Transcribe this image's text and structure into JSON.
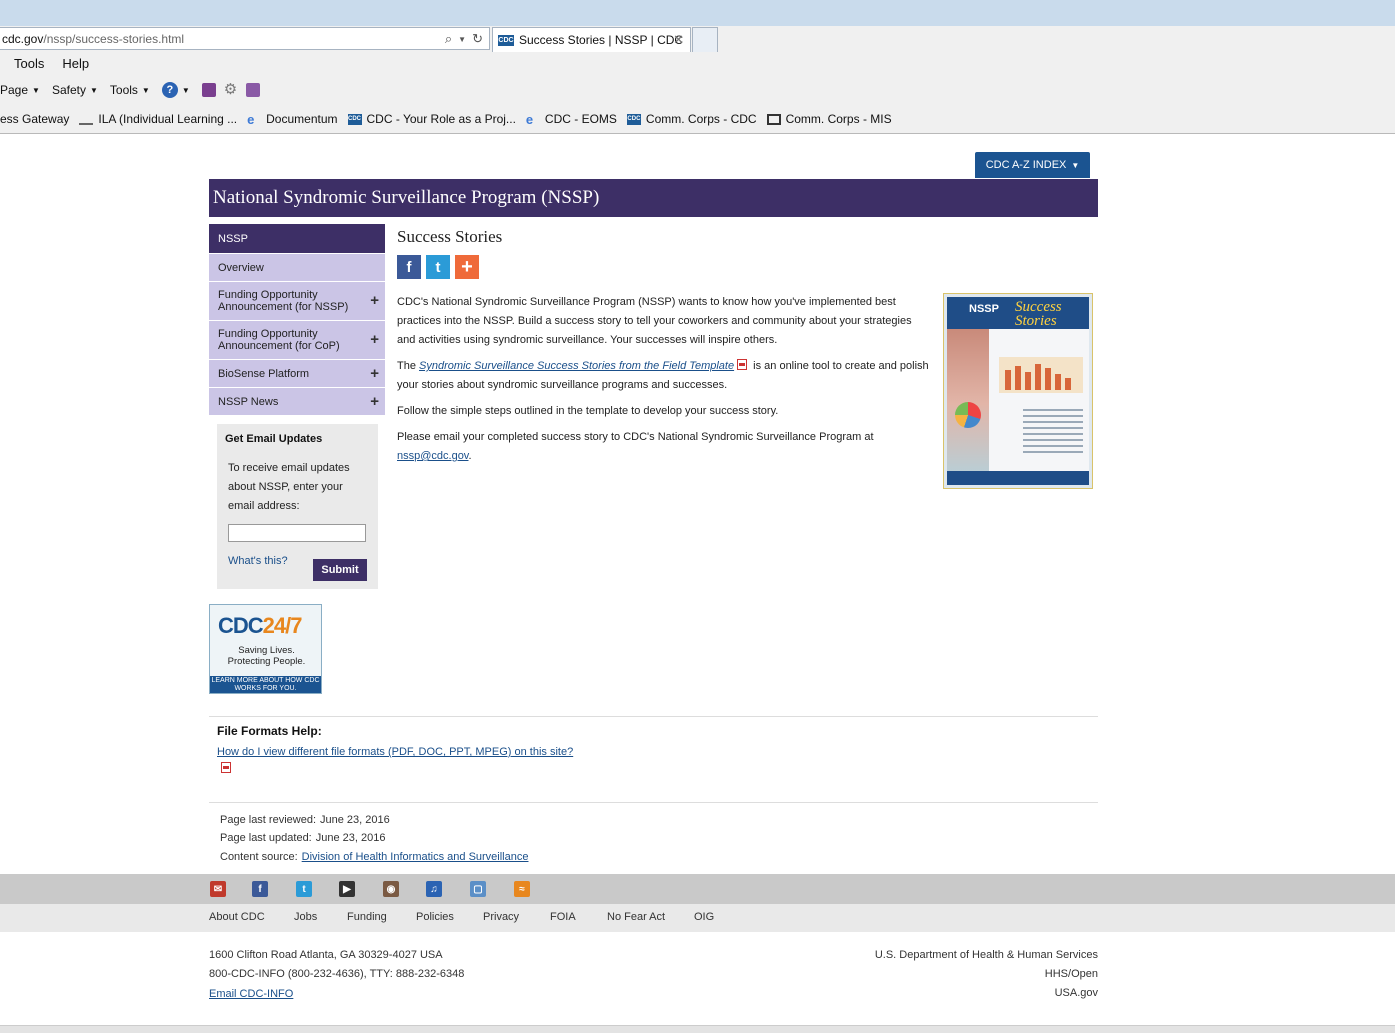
{
  "browser": {
    "address_host": "cdc.gov",
    "address_path": "/nssp/success-stories.html",
    "tab_title": "Success Stories | NSSP | CDC",
    "tab_icon_text": "CDC",
    "menu": [
      "Tools",
      "Help"
    ],
    "commands": [
      "Page",
      "Safety",
      "Tools"
    ],
    "favorites": [
      {
        "label": "ess Gateway",
        "icon": "none"
      },
      {
        "label": "ILA  (Individual Learning ...",
        "icon": "ila-icon"
      },
      {
        "label": "Documentum",
        "icon": "ie-page-icon"
      },
      {
        "label": "CDC - Your Role as a Proj...",
        "icon": "cdc-icon"
      },
      {
        "label": "CDC - EOMS",
        "icon": "ie-page-icon"
      },
      {
        "label": "Comm. Corps - CDC",
        "icon": "cdc-icon"
      },
      {
        "label": "Comm. Corps - MIS",
        "icon": "cc-icon"
      }
    ]
  },
  "header": {
    "az_index": "CDC A-Z INDEX",
    "banner_title": "National Syndromic Surveillance Program (NSSP)"
  },
  "sidenav": {
    "head": "NSSP",
    "items": [
      {
        "label": "Overview",
        "expandable": false
      },
      {
        "label": "Funding Opportunity Announcement (for NSSP)",
        "expandable": true
      },
      {
        "label": "Funding Opportunity Announcement (for CoP)",
        "expandable": true
      },
      {
        "label": "BioSense Platform",
        "expandable": true
      },
      {
        "label": "NSSP News",
        "expandable": true
      }
    ]
  },
  "email": {
    "title": "Get Email Updates",
    "text": "To receive email updates about NSSP, enter your email address:",
    "input_value": "",
    "whats_this": "What's this?",
    "submit": "Submit"
  },
  "promo": {
    "cdc": "CDC",
    "n247": "24/7",
    "tag1": "Saving Lives.",
    "tag2": "Protecting People.",
    "bar": "LEARN MORE ABOUT HOW CDC WORKS FOR YOU."
  },
  "main": {
    "title": "Success Stories",
    "p1": "CDC's National Syndromic Surveillance Program (NSSP) wants to know how you've implemented best practices into the NSSP. Build a success story to tell your coworkers and community about your strategies and activities using syndromic surveillance. Your successes will inspire others.",
    "p2_prefix": "The",
    "p2_link": "Syndromic Surveillance Success Stories from the Field Template",
    "p2_suffix": "is an online tool to create and polish your stories about syndromic surveillance programs and successes.",
    "p3": "Follow the simple steps outlined in the template to develop your success story.",
    "p4_prefix": "Please email your completed success story to CDC's National Syndromic Surveillance Program at",
    "p4_link": "nssp@cdc.gov",
    "p4_suffix": "."
  },
  "thumbnail": {
    "nssp": "NSSP",
    "title": "Success Stories"
  },
  "file_formats": {
    "title": "File Formats Help:",
    "link": "How do I view different file formats (PDF, DOC, PPT, MPEG) on this site?"
  },
  "page_meta": {
    "reviewed_label": "Page last reviewed:",
    "reviewed": "June 23, 2016",
    "updated_label": "Page last updated:",
    "updated": "June 23, 2016",
    "source_label": "Content source:",
    "source": "Division of Health Informatics and Surveillance"
  },
  "footer": {
    "links": [
      "About CDC",
      "Jobs",
      "Funding",
      "Policies",
      "Privacy",
      "FOIA",
      "No Fear Act",
      "OIG"
    ],
    "address": "1600 Clifton Road Atlanta, GA 30329-4027 USA",
    "phone": "800-CDC-INFO (800-232-4636), TTY: 888-232-6348",
    "email": "Email CDC-INFO",
    "hhs": "U.S. Department of Health & Human Services",
    "hhs_open": "HHS/Open",
    "usa": "USA.gov"
  }
}
